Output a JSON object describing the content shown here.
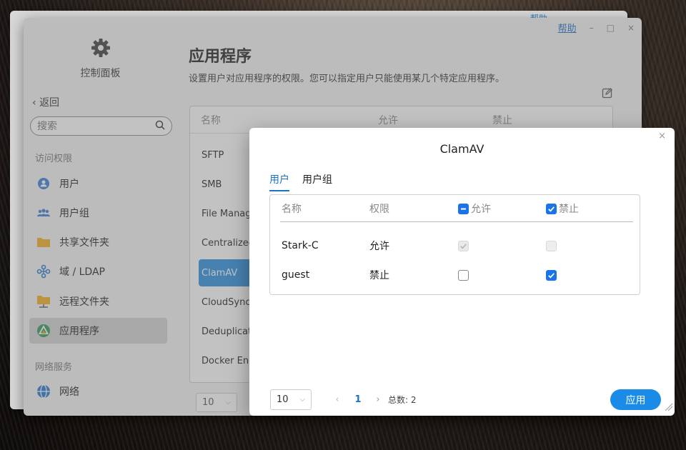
{
  "back_window": {
    "help": "帮助"
  },
  "window": {
    "help_label": "帮助",
    "minimize": "–",
    "maximize": "□",
    "close": "×"
  },
  "sidebar": {
    "title": "控制面板",
    "back_label": "返回",
    "search_placeholder": "搜索",
    "section_access": "访问权限",
    "section_network": "网络服务",
    "items": [
      {
        "label": "用户",
        "icon": "user-icon"
      },
      {
        "label": "用户组",
        "icon": "user-group-icon"
      },
      {
        "label": "共享文件夹",
        "icon": "folder-icon"
      },
      {
        "label": "域 / LDAP",
        "icon": "domain-icon"
      },
      {
        "label": "远程文件夹",
        "icon": "remote-folder-icon"
      },
      {
        "label": "应用程序",
        "icon": "app-icon",
        "active": true
      },
      {
        "label": "网络",
        "icon": "network-icon"
      }
    ]
  },
  "main": {
    "title": "应用程序",
    "description": "设置用户对应用程序的权限。您可以指定用户只能使用某几个特定应用程序。",
    "columns": {
      "name": "名称",
      "allow": "允许",
      "deny": "禁止"
    },
    "apps": [
      "SFTP",
      "SMB",
      "File Manag",
      "Centralized",
      "ClamAV",
      "CloudSync",
      "Deduplicati",
      "Docker Eng"
    ],
    "active_app": "ClamAV",
    "page_size": "10"
  },
  "dialog": {
    "title": "ClamAV",
    "close": "×",
    "tabs": [
      {
        "label": "用户",
        "active": true
      },
      {
        "label": "用户组",
        "active": false
      }
    ],
    "columns": {
      "name": "名称",
      "permission": "权限",
      "allow": "允许",
      "deny": "禁止"
    },
    "rows": [
      {
        "name": "Stark-C",
        "permission": "允许",
        "allow": true,
        "deny": false,
        "disabled": true
      },
      {
        "name": "guest",
        "permission": "禁止",
        "allow": false,
        "deny": true,
        "disabled": false
      }
    ],
    "page_size": "10",
    "current_page": "1",
    "total": "总数: 2",
    "apply_label": "应用"
  },
  "colors": {
    "accent": "#1a73e8",
    "apply": "#1a8ce8",
    "active_row": "#2a8fe0"
  }
}
